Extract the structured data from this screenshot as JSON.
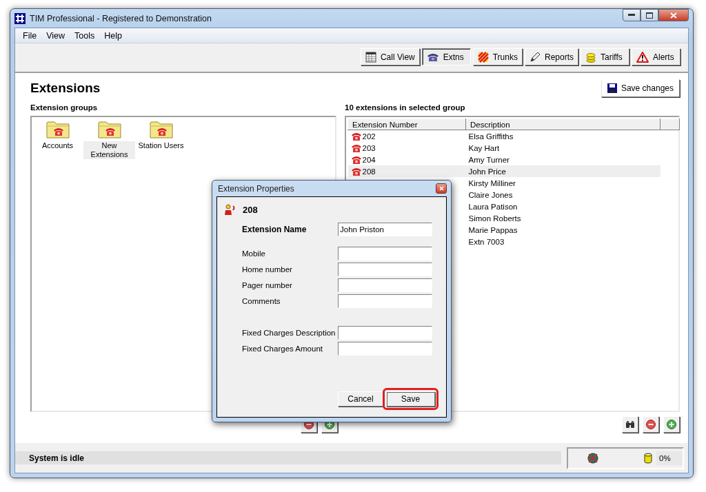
{
  "window": {
    "title": "TIM Professional - Registered to Demonstration"
  },
  "menu": [
    "File",
    "View",
    "Tools",
    "Help"
  ],
  "toolbar": [
    {
      "label": "Call View",
      "kind": "grid",
      "selected": false
    },
    {
      "label": "Extns",
      "kind": "phone",
      "selected": true
    },
    {
      "label": "Trunks",
      "kind": "stripes",
      "selected": false
    },
    {
      "label": "Reports",
      "kind": "pen",
      "selected": false
    },
    {
      "label": "Tariffs",
      "kind": "coins",
      "selected": false
    },
    {
      "label": "Alerts",
      "kind": "warning",
      "selected": false
    }
  ],
  "page": {
    "title": "Extensions",
    "save_button": "Save changes"
  },
  "groups": {
    "heading": "Extension groups",
    "items": [
      {
        "label": "Accounts",
        "selected": false
      },
      {
        "label": "New Extensions",
        "selected": true
      },
      {
        "label": "Station Users",
        "selected": false
      }
    ]
  },
  "extensions": {
    "heading": "10 extensions in selected group",
    "columns": [
      "Extension Number",
      "Description"
    ],
    "rows": [
      {
        "number": "202",
        "description": "Elsa Griffiths",
        "selected": false
      },
      {
        "number": "203",
        "description": "Kay Hart",
        "selected": false
      },
      {
        "number": "204",
        "description": "Amy Turner",
        "selected": false
      },
      {
        "number": "208",
        "description": "John Price",
        "selected": true
      },
      {
        "description": "Kirsty Milliner",
        "selected": false
      },
      {
        "description": "Claire Jones",
        "selected": false
      },
      {
        "description": "Laura Patison",
        "selected": false
      },
      {
        "description": "Simon Roberts",
        "selected": false
      },
      {
        "description": "Marie Pappas",
        "selected": false
      },
      {
        "description": "Extn 7003",
        "selected": false
      }
    ]
  },
  "status": {
    "text": "System is idle",
    "percent": "0%"
  },
  "dialog": {
    "title": "Extension Properties",
    "extension": "208",
    "name_field": {
      "label": "Extension Name",
      "value": "John Priston"
    },
    "field_sections": [
      [
        {
          "label": "Mobile"
        },
        {
          "label": "Home number"
        },
        {
          "label": "Pager number"
        },
        {
          "label": "Comments"
        }
      ],
      [
        {
          "label": "Fixed Charges Description"
        },
        {
          "label": "Fixed Charges Amount"
        }
      ]
    ],
    "buttons": [
      {
        "label": "Cancel",
        "highlighted": false
      },
      {
        "label": "Save",
        "highlighted": true
      }
    ]
  }
}
